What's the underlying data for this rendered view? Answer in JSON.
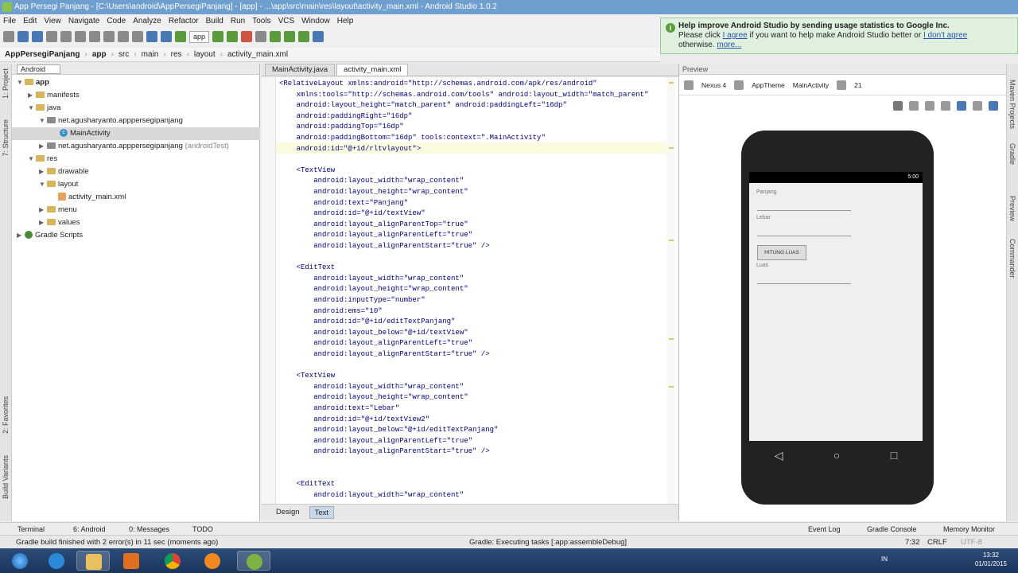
{
  "window": {
    "title": "App Persegi Panjang - [C:\\Users\\android\\AppPersegiPanjang] - [app] - ...\\app\\src\\main\\res\\layout\\activity_main.xml - Android Studio 1.0.2"
  },
  "menu": [
    "File",
    "Edit",
    "View",
    "Navigate",
    "Code",
    "Analyze",
    "Refactor",
    "Build",
    "Run",
    "Tools",
    "VCS",
    "Window",
    "Help"
  ],
  "toolbar": {
    "run_config": "app"
  },
  "notification": {
    "title": "Help improve Android Studio by sending usage statistics to Google Inc.",
    "line2_pre": "Please click ",
    "agree": "I agree",
    "line2_mid": " if you want to help make Android Studio better or ",
    "disagree": "I don't agree",
    "line3_pre": "otherwise. ",
    "more": "more..."
  },
  "breadcrumb": [
    "AppPersegiPanjang",
    "app",
    "src",
    "main",
    "res",
    "layout",
    "activity_main.xml"
  ],
  "project": {
    "view_selector": "Android",
    "tree": [
      {
        "label": "app",
        "bold": true
      },
      {
        "label": "manifests"
      },
      {
        "label": "java"
      },
      {
        "label": "net.agusharyanto.apppersegipanjang"
      },
      {
        "label": "MainActivity"
      },
      {
        "label": "net.agusharyanto.apppersegipanjang",
        "suffix": "(androidTest)"
      },
      {
        "label": "res"
      },
      {
        "label": "drawable"
      },
      {
        "label": "layout"
      },
      {
        "label": "activity_main.xml"
      },
      {
        "label": "menu"
      },
      {
        "label": "values"
      },
      {
        "label": "Gradle Scripts"
      }
    ]
  },
  "editor_tabs": [
    "MainActivity.java",
    "activity_main.xml"
  ],
  "code": [
    "<RelativeLayout xmlns:android=\"http://schemas.android.com/apk/res/android\"",
    "    xmlns:tools=\"http://schemas.android.com/tools\" android:layout_width=\"match_parent\"",
    "    android:layout_height=\"match_parent\" android:paddingLeft=\"16dp\"",
    "    android:paddingRight=\"16dp\"",
    "    android:paddingTop=\"16dp\"",
    "    android:paddingBottom=\"16dp\" tools:context=\".MainActivity\"",
    "    android:id=\"@+id/rltvlayout\">",
    "",
    "    <TextView",
    "        android:layout_width=\"wrap_content\"",
    "        android:layout_height=\"wrap_content\"",
    "        android:text=\"Panjang\"",
    "        android:id=\"@+id/textView\"",
    "        android:layout_alignParentTop=\"true\"",
    "        android:layout_alignParentLeft=\"true\"",
    "        android:layout_alignParentStart=\"true\" />",
    "",
    "    <EditText",
    "        android:layout_width=\"wrap_content\"",
    "        android:layout_height=\"wrap_content\"",
    "        android:inputType=\"number\"",
    "        android:ems=\"10\"",
    "        android:id=\"@+id/editTextPanjang\"",
    "        android:layout_below=\"@+id/textView\"",
    "        android:layout_alignParentLeft=\"true\"",
    "        android:layout_alignParentStart=\"true\" />",
    "",
    "    <TextView",
    "        android:layout_width=\"wrap_content\"",
    "        android:layout_height=\"wrap_content\"",
    "        android:text=\"Lebar\"",
    "        android:id=\"@+id/textView2\"",
    "        android:layout_below=\"@+id/editTextPanjang\"",
    "        android:layout_alignParentLeft=\"true\"",
    "        android:layout_alignParentStart=\"true\" />",
    "",
    "",
    "    <EditText",
    "        android:layout_width=\"wrap_content\""
  ],
  "design_tabs": [
    "Design",
    "Text"
  ],
  "preview": {
    "header": "Preview",
    "device": "Nexus 4",
    "theme": "AppTheme",
    "activity": "MainActivity",
    "api": "21",
    "status_time": "5:00",
    "label_panjang": "Panjang",
    "label_lebar": "Lebar",
    "button": "HITUNG LUAS",
    "label_luas": "Luas"
  },
  "left_tabs": [
    "1: Project",
    "7: Structure",
    "2: Favorites",
    "Build Variants"
  ],
  "right_tabs": [
    "Maven Projects",
    "Gradle",
    "Preview",
    "Commander"
  ],
  "tool_windows": [
    "Terminal",
    "6: Android",
    "0: Messages",
    "TODO",
    "Event Log",
    "Gradle Console",
    "Memory Monitor"
  ],
  "status": {
    "message": "Gradle build finished with 2 error(s) in 11 sec (moments ago)",
    "task": "Gradle: Executing tasks [:app:assembleDebug]",
    "position": "7:32",
    "line_sep": "CRLF",
    "encoding": "UTF-8"
  },
  "taskbar": {
    "lang": "IN",
    "time": "13:32",
    "date": "01/01/2015"
  }
}
